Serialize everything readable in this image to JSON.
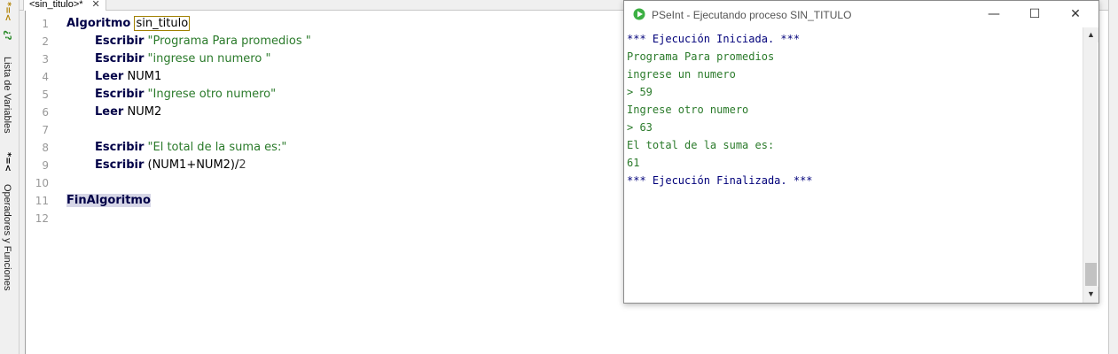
{
  "sidebar": {
    "variables_label": "Lista de Variables",
    "operators_label": "Operadores y Funciones",
    "icon_var": "*=<",
    "icon_help": "¿?"
  },
  "tab": {
    "label": "<sin_titulo>*",
    "close": "✕"
  },
  "editor": {
    "line_numbers": [
      "1",
      "2",
      "3",
      "4",
      "5",
      "6",
      "7",
      "8",
      "9",
      "10",
      "11",
      "12"
    ],
    "lines": {
      "l1_kw": "Algoritmo",
      "l1_name": "sin_titulo",
      "l2_kw": "Escribir",
      "l2_str": "\"Programa Para promedios \"",
      "l3_kw": "Escribir",
      "l3_str": "\"ingrese un numero \"",
      "l4_kw": "Leer",
      "l4_var": "NUM1",
      "l5_kw": "Escribir",
      "l5_str": "\"Ingrese otro numero\"",
      "l6_kw": "Leer",
      "l6_var": "NUM2",
      "l8_kw": "Escribir",
      "l8_str": "\"El total de la suma es:\"",
      "l9_kw": "Escribir",
      "l9_expr": "(NUM1+NUM2)/",
      "l9_num": "2",
      "l11_kw": "FinAlgoritmo"
    }
  },
  "console_window": {
    "title": "PSeInt - Ejecutando proceso SIN_TITULO",
    "minimize": "—",
    "maximize": "☐",
    "close": "✕",
    "lines": [
      "*** Ejecución Iniciada. ***",
      "Programa Para promedios",
      "ingrese un numero",
      "> 59",
      "Ingrese otro numero",
      "> 63",
      "El total de la suma es:",
      "61",
      "*** Ejecución Finalizada. ***"
    ],
    "scroll_up": "▲",
    "scroll_down": "▼"
  },
  "colors": {
    "keyword": "#000047",
    "string": "#2a7a2a",
    "system": "#00007a",
    "run_icon": "#3cb043"
  }
}
